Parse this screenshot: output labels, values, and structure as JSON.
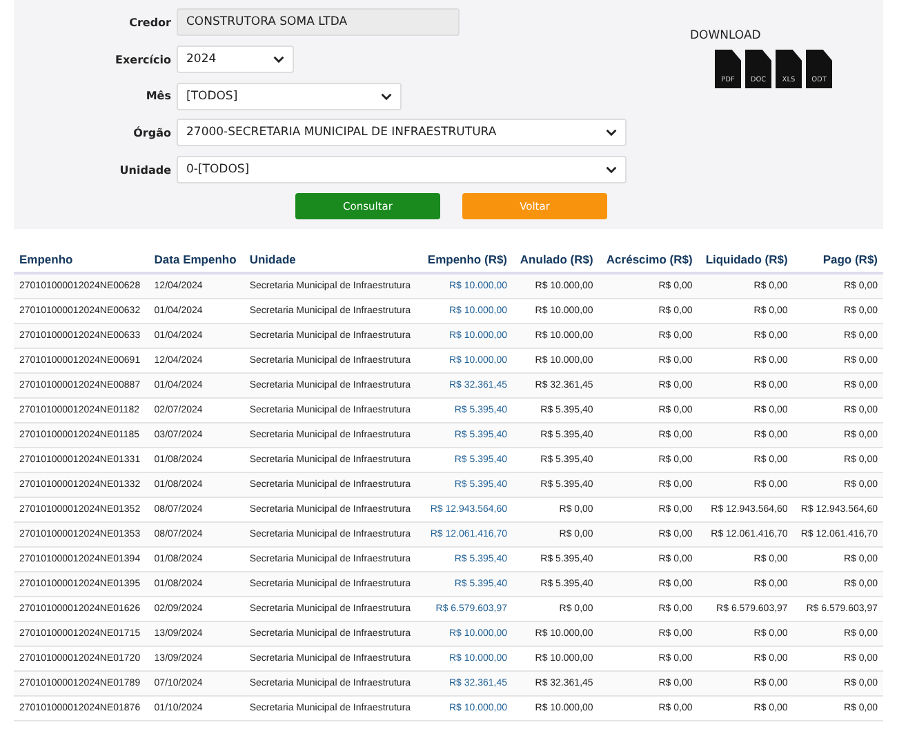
{
  "form": {
    "fields": [
      {
        "label": "Credor",
        "kind": "readonly",
        "value": "CONSTRUTORA SOMA LTDA"
      },
      {
        "label": "Exercício",
        "kind": "select",
        "value": "2024"
      },
      {
        "label": "Mês",
        "kind": "select",
        "value": "[TODOS]"
      },
      {
        "label": "Órgão",
        "kind": "select",
        "value": "27000-SECRETARIA MUNICIPAL DE INFRAESTRUTURA"
      },
      {
        "label": "Unidade",
        "kind": "select",
        "value": "0-[TODOS]"
      }
    ],
    "buttons": [
      {
        "label": "Consultar",
        "kind": "primary"
      },
      {
        "label": "Voltar",
        "kind": "warning"
      }
    ]
  },
  "download": {
    "title": "DOWNLOAD",
    "formats": [
      "PDF",
      "DOC",
      "XLS",
      "ODT"
    ]
  },
  "table": {
    "columns": [
      {
        "label": "Empenho",
        "kind": "text"
      },
      {
        "label": "Data Empenho",
        "kind": "text"
      },
      {
        "label": "Unidade",
        "kind": "text"
      },
      {
        "label": "Empenho (R$)",
        "kind": "link"
      },
      {
        "label": "Anulado (R$)",
        "kind": "money"
      },
      {
        "label": "Acréscimo (R$)",
        "kind": "money"
      },
      {
        "label": "Liquidado (R$)",
        "kind": "money"
      },
      {
        "label": "Pago (R$)",
        "kind": "money"
      }
    ],
    "rows": [
      [
        "270101000012024NE00628",
        "12/04/2024",
        "Secretaria Municipal de Infraestrutura",
        "R$ 10.000,00",
        "R$ 10.000,00",
        "R$ 0,00",
        "R$ 0,00",
        "R$ 0,00"
      ],
      [
        "270101000012024NE00632",
        "01/04/2024",
        "Secretaria Municipal de Infraestrutura",
        "R$ 10.000,00",
        "R$ 10.000,00",
        "R$ 0,00",
        "R$ 0,00",
        "R$ 0,00"
      ],
      [
        "270101000012024NE00633",
        "01/04/2024",
        "Secretaria Municipal de Infraestrutura",
        "R$ 10.000,00",
        "R$ 10.000,00",
        "R$ 0,00",
        "R$ 0,00",
        "R$ 0,00"
      ],
      [
        "270101000012024NE00691",
        "12/04/2024",
        "Secretaria Municipal de Infraestrutura",
        "R$ 10.000,00",
        "R$ 10.000,00",
        "R$ 0,00",
        "R$ 0,00",
        "R$ 0,00"
      ],
      [
        "270101000012024NE00887",
        "01/04/2024",
        "Secretaria Municipal de Infraestrutura",
        "R$ 32.361,45",
        "R$ 32.361,45",
        "R$ 0,00",
        "R$ 0,00",
        "R$ 0,00"
      ],
      [
        "270101000012024NE01182",
        "02/07/2024",
        "Secretaria Municipal de Infraestrutura",
        "R$ 5.395,40",
        "R$ 5.395,40",
        "R$ 0,00",
        "R$ 0,00",
        "R$ 0,00"
      ],
      [
        "270101000012024NE01185",
        "03/07/2024",
        "Secretaria Municipal de Infraestrutura",
        "R$ 5.395,40",
        "R$ 5.395,40",
        "R$ 0,00",
        "R$ 0,00",
        "R$ 0,00"
      ],
      [
        "270101000012024NE01331",
        "01/08/2024",
        "Secretaria Municipal de Infraestrutura",
        "R$ 5.395,40",
        "R$ 5.395,40",
        "R$ 0,00",
        "R$ 0,00",
        "R$ 0,00"
      ],
      [
        "270101000012024NE01332",
        "01/08/2024",
        "Secretaria Municipal de Infraestrutura",
        "R$ 5.395,40",
        "R$ 5.395,40",
        "R$ 0,00",
        "R$ 0,00",
        "R$ 0,00"
      ],
      [
        "270101000012024NE01352",
        "08/07/2024",
        "Secretaria Municipal de Infraestrutura",
        "R$ 12.943.564,60",
        "R$ 0,00",
        "R$ 0,00",
        "R$ 12.943.564,60",
        "R$ 12.943.564,60"
      ],
      [
        "270101000012024NE01353",
        "08/07/2024",
        "Secretaria Municipal de Infraestrutura",
        "R$ 12.061.416,70",
        "R$ 0,00",
        "R$ 0,00",
        "R$ 12.061.416,70",
        "R$ 12.061.416,70"
      ],
      [
        "270101000012024NE01394",
        "01/08/2024",
        "Secretaria Municipal de Infraestrutura",
        "R$ 5.395,40",
        "R$ 5.395,40",
        "R$ 0,00",
        "R$ 0,00",
        "R$ 0,00"
      ],
      [
        "270101000012024NE01395",
        "01/08/2024",
        "Secretaria Municipal de Infraestrutura",
        "R$ 5.395,40",
        "R$ 5.395,40",
        "R$ 0,00",
        "R$ 0,00",
        "R$ 0,00"
      ],
      [
        "270101000012024NE01626",
        "02/09/2024",
        "Secretaria Municipal de Infraestrutura",
        "R$ 6.579.603,97",
        "R$ 0,00",
        "R$ 0,00",
        "R$ 6.579.603,97",
        "R$ 6.579.603,97"
      ],
      [
        "270101000012024NE01715",
        "13/09/2024",
        "Secretaria Municipal de Infraestrutura",
        "R$ 10.000,00",
        "R$ 10.000,00",
        "R$ 0,00",
        "R$ 0,00",
        "R$ 0,00"
      ],
      [
        "270101000012024NE01720",
        "13/09/2024",
        "Secretaria Municipal de Infraestrutura",
        "R$ 10.000,00",
        "R$ 10.000,00",
        "R$ 0,00",
        "R$ 0,00",
        "R$ 0,00"
      ],
      [
        "270101000012024NE01789",
        "07/10/2024",
        "Secretaria Municipal de Infraestrutura",
        "R$ 32.361,45",
        "R$ 32.361,45",
        "R$ 0,00",
        "R$ 0,00",
        "R$ 0,00"
      ],
      [
        "270101000012024NE01876",
        "01/10/2024",
        "Secretaria Municipal de Infraestrutura",
        "R$ 10.000,00",
        "R$ 10.000,00",
        "R$ 0,00",
        "R$ 0,00",
        "R$ 0,00"
      ]
    ]
  }
}
